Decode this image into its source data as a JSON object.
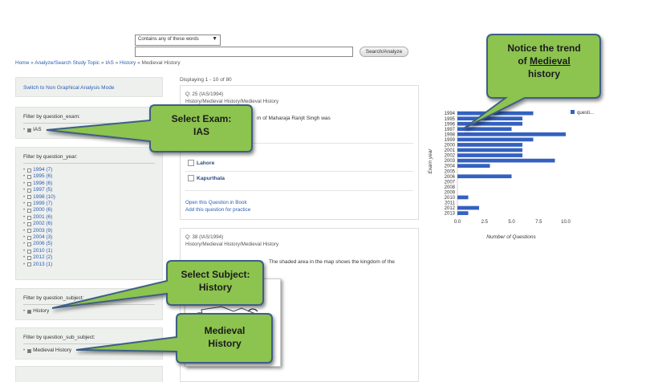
{
  "search": {
    "mode_select": "Contains any of these words",
    "query": "",
    "button": "Search/Analyze"
  },
  "breadcrumb": {
    "home": "Home",
    "sep": "»",
    "study_topic": "Analyze/Search Study Topic",
    "ias": "IAS",
    "history": "History",
    "current": "Medieval History"
  },
  "sidebar": {
    "mode_link": "Switch to Non Graphical Analysis Mode",
    "exam": {
      "title": "Filter by question_exam:",
      "options": [
        {
          "label": "IAS"
        }
      ]
    },
    "year": {
      "title": "Filter by question_year:",
      "options": [
        {
          "label": "1994 (7)"
        },
        {
          "label": "1995 (6)"
        },
        {
          "label": "1996 (6)"
        },
        {
          "label": "1997 (5)"
        },
        {
          "label": "1998 (10)"
        },
        {
          "label": "1999 (7)"
        },
        {
          "label": "2000 (6)"
        },
        {
          "label": "2001 (6)"
        },
        {
          "label": "2002 (6)"
        },
        {
          "label": "2003 (9)"
        },
        {
          "label": "2004 (3)"
        },
        {
          "label": "2006 (5)"
        },
        {
          "label": "2010 (1)"
        },
        {
          "label": "2012 (2)"
        },
        {
          "label": "2013 (1)"
        }
      ]
    },
    "subject": {
      "title": "Filter by question_subject:",
      "options": [
        {
          "label": "History"
        }
      ]
    },
    "sub_subject": {
      "title": "Filter by question_sub_subject:",
      "options": [
        {
          "label": "Medieval History"
        }
      ]
    }
  },
  "results": {
    "displaying": "Displaying 1 - 10 of 80",
    "q1": {
      "meta1": "Q: 25 (IAS/1994)",
      "meta2": "History/Medieval History/Medieval History",
      "text": "m of Maharaja Ranjit Singh was",
      "options": [
        "Lahore",
        "Kapurthala"
      ],
      "link_book": "Open this Question in Book",
      "link_practice": "Add this question for practice"
    },
    "q2": {
      "meta1": "Q: 38 (IAS/1994)",
      "meta2": "History/Medieval History/Medieval History",
      "text": "The shaded area in the map shows the kingdom of the"
    }
  },
  "callouts": {
    "exam": [
      "Select Exam:",
      "IAS"
    ],
    "subject": [
      "Select Subject:",
      "History"
    ],
    "sub_subject": [
      "Medieval",
      "History"
    ],
    "trend_line1": "Notice the trend",
    "trend_line2_pre": "of ",
    "trend_line2_ul": "Medieval",
    "trend_line3": "history"
  },
  "colors": {
    "bar": "#3461c0",
    "callout_fill": "#8dc34f",
    "callout_stroke": "#3c5e86",
    "link": "#2a5db0",
    "panel_bg": "#eef0ee"
  },
  "chart_data": {
    "type": "bar",
    "orientation": "horizontal",
    "categories": [
      "1994",
      "1995",
      "1996",
      "1997",
      "1998",
      "1999",
      "2000",
      "2001",
      "2002",
      "2003",
      "2004",
      "2005",
      "2006",
      "2007",
      "2008",
      "2009",
      "2010",
      "2011",
      "2012",
      "2013"
    ],
    "series": [
      {
        "name": "questi...",
        "values": [
          7,
          6,
          6,
          5,
          10,
          7,
          6,
          6,
          6,
          9,
          3,
          0,
          5,
          0,
          0,
          0,
          1,
          0,
          2,
          1
        ]
      }
    ],
    "xlabel": "Number of Questions",
    "ylabel": "Exam year",
    "xlim": [
      0,
      10
    ],
    "xticks": [
      "0.0",
      "2.5",
      "5.0",
      "7.5",
      "10.0"
    ],
    "legend": "top-right",
    "grid": false
  }
}
